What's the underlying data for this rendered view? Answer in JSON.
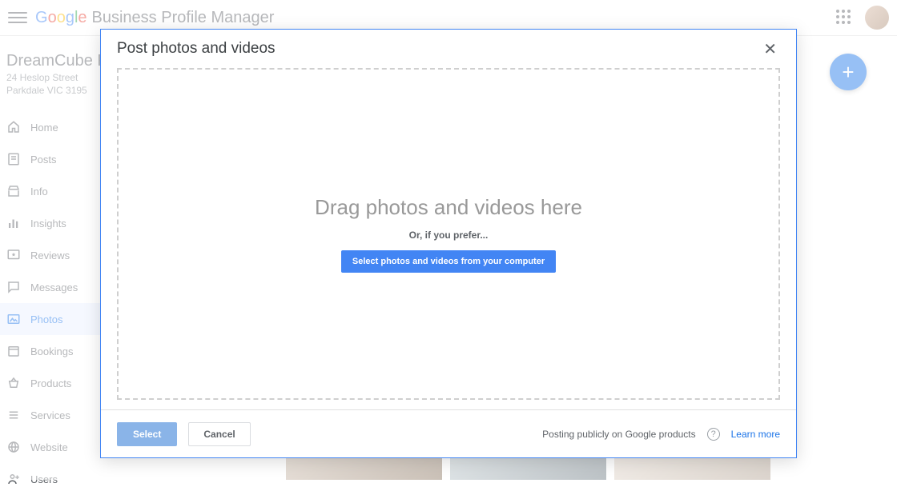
{
  "header": {
    "product_name": "Business Profile Manager"
  },
  "business": {
    "name": "DreamCube Pro",
    "addr1": "24 Heslop Street",
    "addr2": "Parkdale VIC 3195"
  },
  "nav": {
    "home": "Home",
    "posts": "Posts",
    "info": "Info",
    "insights": "Insights",
    "reviews": "Reviews",
    "messages": "Messages",
    "photos": "Photos",
    "bookings": "Bookings",
    "products": "Products",
    "services": "Services",
    "website": "Website",
    "users": "Users"
  },
  "modal": {
    "title": "Post photos and videos",
    "drop_title": "Drag photos and videos here",
    "drop_sub": "Or, if you prefer...",
    "select_computer": "Select photos and videos from your computer",
    "select": "Select",
    "cancel": "Cancel",
    "posting_note": "Posting publicly on Google products",
    "learn_more": "Learn more",
    "help_glyph": "?"
  },
  "fab": {
    "glyph": "+"
  }
}
